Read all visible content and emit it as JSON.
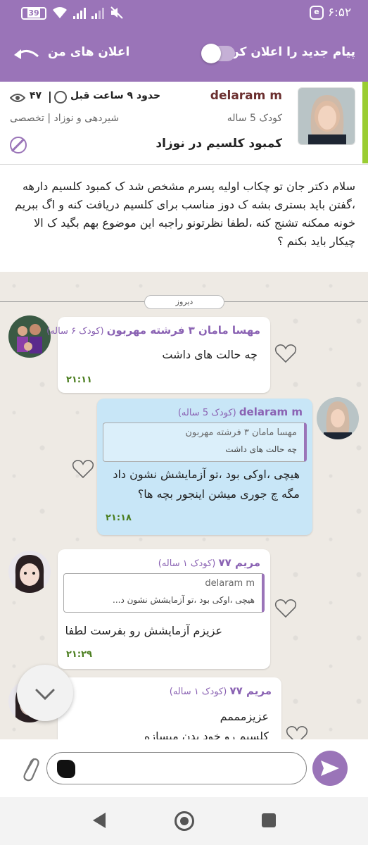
{
  "status_bar": {
    "time": "۶:۵۲",
    "battery": "39",
    "app_icon": "e-app-icon",
    "icons": [
      "battery-icon",
      "wifi-icon",
      "signal-icon",
      "signal-icon",
      "mute-icon"
    ]
  },
  "header": {
    "notify_label": "پیام جدید را اعلان کن",
    "my_announcements_label": "اعلان های من",
    "back_icon": "back-arrow-icon",
    "toggle_on": false
  },
  "question": {
    "author": "delaram m",
    "time_ago": "حدود ۹ ساعت قبل",
    "views": "۴۷",
    "separator": "|",
    "child_age": "کودک 5 ساله",
    "category": "شیردهی و نوزاد | تخصصی",
    "title": "کمبود کلسیم در نوزاد",
    "body": "سلام دکتر جان تو چکاب اولیه پسرم مشخص شد ک کمبود کلسیم دارهه ،گفتن باید بستری بشه ک دوز مناسب برای کلسیم دریافت کنه و اگ ببریم خونه ممکنه تشنج کنه ،لطفا نظرتونو راجبه این موضوع بهم بگید ک الا چیکار باید بکنم ؟"
  },
  "chat": {
    "date_label": "دیروز",
    "messages": [
      {
        "name": "مهسا مامان ۳ فرشته مهربون",
        "meta": "(کودک ۶ ساله)",
        "text": "چه حالت های داشت",
        "time": "۲۱:۱۱"
      },
      {
        "name": "delaram m",
        "meta": "(کودک 5 ساله)",
        "reply_name": "مهسا مامان ۳ فرشته مهربون",
        "reply_text": "چه حالت های داشت",
        "text_line1": "هیچی ،اوکی بود ،تو آزمایشش نشون داد",
        "text_line2": "مگه چ جوری میشن اینجور بچه ها؟",
        "time": "۲۱:۱۸"
      },
      {
        "name": "مریم ۷۷",
        "meta": "(کودک ۱ ساله)",
        "reply_name": "delaram m",
        "reply_text": "هیچی ،اوکی بود ،تو آزمایشش نشون د...",
        "text": "عزیزم آزمایشش  رو بفرست لطفا",
        "time": "۲۱:۲۹"
      },
      {
        "name": "مریم ۷۷",
        "meta": "(کودک ۱ ساله)",
        "text_line1": "عزیزمممم",
        "text_line2": "کلسیم رو خود بدن میسازه"
      }
    ]
  },
  "input": {
    "placeholder": ""
  }
}
